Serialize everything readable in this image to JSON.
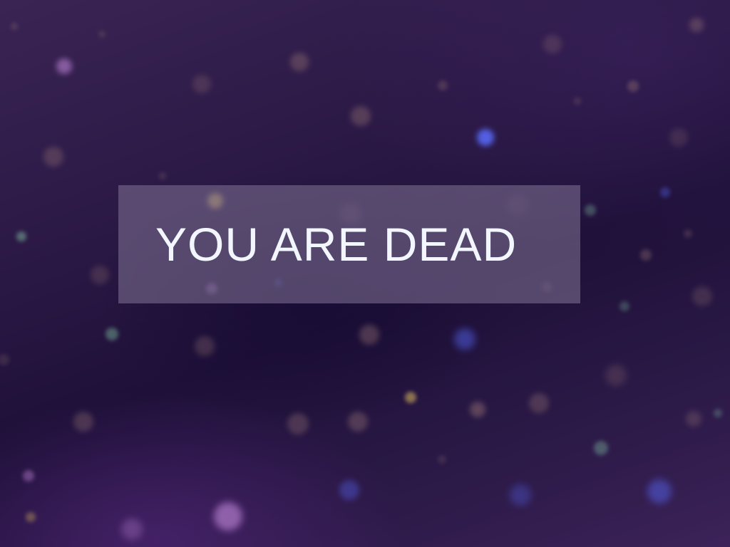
{
  "game_over": {
    "message": "YOU ARE DEAD"
  },
  "colors": {
    "background_dark": "#1e1038",
    "background_light": "#3c2258",
    "panel": "#7f6c8f",
    "text": "#f2f6ff",
    "orb_blue": "#5a6cff",
    "orb_yellow": "#e0c060",
    "orb_teal": "#7fbfa0",
    "orb_pink": "#c88ce0",
    "orb_brown": "#8a6a70"
  }
}
